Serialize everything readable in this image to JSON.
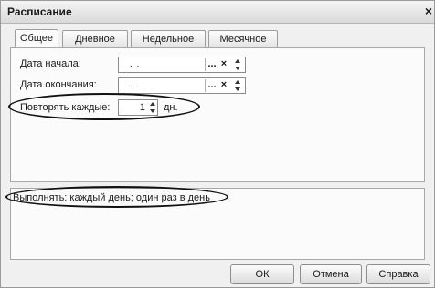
{
  "window": {
    "title": "Расписание",
    "close_label": "×"
  },
  "tabs": [
    {
      "label": "Общее",
      "active": true
    },
    {
      "label": "Дневное",
      "active": false
    },
    {
      "label": "Недельное",
      "active": false
    },
    {
      "label": "Месячное",
      "active": false
    }
  ],
  "general": {
    "start_date": {
      "label": "Дата начала:",
      "value": ". ."
    },
    "end_date": {
      "label": "Дата окончания:",
      "value": ". ."
    },
    "repeat": {
      "label": "Повторять каждые:",
      "value": "1",
      "unit": "дн."
    },
    "choice_label": "...",
    "clear_label": "×"
  },
  "summary": {
    "text": "Выполнять: каждый день; один раз в день"
  },
  "buttons": {
    "ok": "ОК",
    "cancel": "Отмена",
    "help": "Справка"
  }
}
